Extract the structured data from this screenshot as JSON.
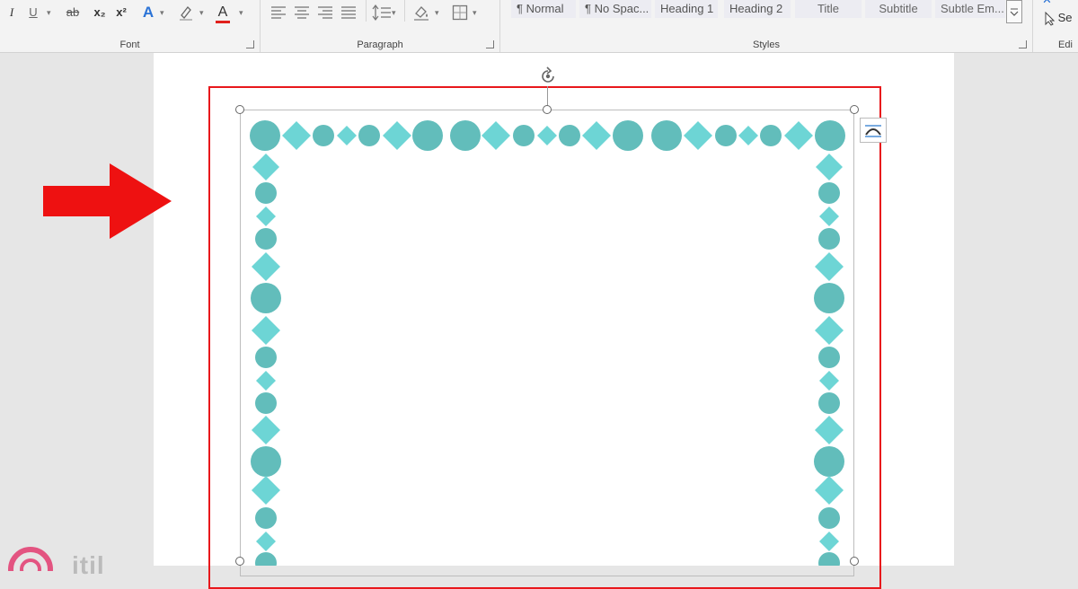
{
  "ribbon": {
    "font_group": {
      "label": "Font",
      "buttons": [
        {
          "name": "italic-button",
          "text": "I"
        },
        {
          "name": "underline-button",
          "text": "U"
        },
        {
          "name": "strikethrough-button",
          "text": "ab"
        },
        {
          "name": "subscript-button",
          "text": "x₂"
        },
        {
          "name": "superscript-button",
          "text": "x²"
        },
        {
          "name": "text-effects-button",
          "text": "A"
        },
        {
          "name": "highlight-button",
          "text": "🖉"
        },
        {
          "name": "font-color-button",
          "text": "A"
        }
      ]
    },
    "paragraph_group": {
      "label": "Paragraph"
    },
    "styles_group": {
      "label": "Styles",
      "items": [
        "¶ Normal",
        "¶ No Spac...",
        "Heading 1",
        "Heading 2",
        "Title",
        "Subtitle",
        "Subtle Em..."
      ]
    },
    "editing_group": {
      "select_label": "Se",
      "label": "Edi"
    }
  },
  "watermark": {
    "text": "itil"
  },
  "colors": {
    "teal_circle": "#62bdbb",
    "teal_diamond": "#6dd5d5",
    "red_frame": "#e8181c",
    "red_arrow": "#ee1111",
    "font_color_bar": "#e0201c"
  }
}
